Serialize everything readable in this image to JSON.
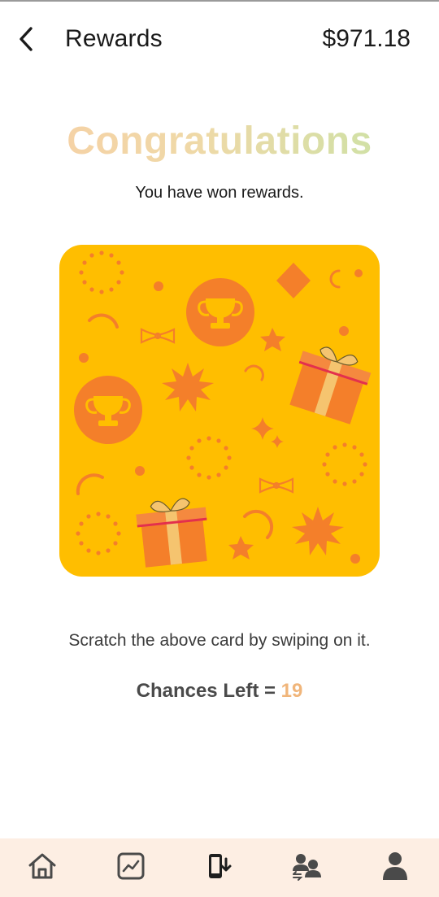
{
  "header": {
    "title": "Rewards",
    "balance": "$971.18"
  },
  "main": {
    "heading": "Congratulations",
    "subtitle": "You have won rewards.",
    "instruction": "Scratch the above card by swiping on it.",
    "chances_label": "Chances Left = ",
    "chances_count": "19"
  },
  "colors": {
    "card_background": "#ffbe00",
    "card_shapes": "#f47f2a",
    "chances_count": "#f0b57a",
    "bottom_nav_background": "#fdeee3"
  },
  "bottom_nav": {
    "items": [
      {
        "icon": "home-icon"
      },
      {
        "icon": "chart-icon"
      },
      {
        "icon": "phone-download-icon"
      },
      {
        "icon": "transfer-people-icon"
      },
      {
        "icon": "profile-icon"
      }
    ]
  }
}
